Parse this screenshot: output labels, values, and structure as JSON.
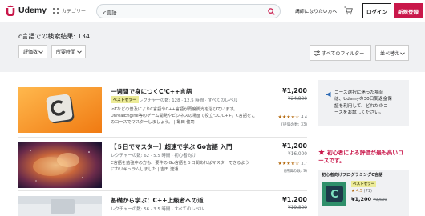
{
  "header": {
    "logo": "Udemy",
    "categories": "カテゴリー",
    "search_value": "c言語",
    "business_text": "講師になりたい方へ",
    "login": "ログイン",
    "signup": "新規登録"
  },
  "results": {
    "title": "c言語での検索結果: 134",
    "chip_rating": "評価数",
    "chip_duration": "所要時間",
    "all_filters": "すべてのフィルター",
    "sort": "並べ替え"
  },
  "courses": [
    {
      "title": "一週間で身につくC/C++言語",
      "badge": "ベストセラー",
      "meta": "レクチャーの数: 128 · 12.5 時間 · すべてのレベル",
      "desc_lines": [
        "IoTなどの普及によりC言語やC++言語が再度脚光を浴びています。",
        "UnrealEngine等のゲーム開発やビジネスの場面で役立つC/C++。C言語をこ",
        "のコースでマスターしましょう。 | 亀田 健司"
      ],
      "price": "¥1,200",
      "old_price": "¥24,800",
      "stars": "★★★★☆",
      "rating": "4.4",
      "reviews": "(評価の数: 33)"
    },
    {
      "title": "【５日でマスター】超速で学ぶ Go言語 入門",
      "meta": "レクチャーの数: 62 · 5.5 時間 · 初心者向け",
      "desc_lines": [
        "C言語を勉強中の方も、要件の Go言語を５日間あればマスターできるよう",
        "にカリキュラムしました | 吉田 遼通"
      ],
      "price": "¥1,200",
      "old_price": "¥16,000",
      "stars": "★★★★☆",
      "rating": "3.7",
      "reviews": "(評価の数: 9)"
    },
    {
      "title": "基礎から学ぶ：C++上級者への道",
      "meta": "レクチャーの数: 56 · 3.5 時間 · すべてのレベル",
      "price": "¥1,200",
      "old_price": "¥19,800"
    }
  ],
  "sidebar": {
    "note_lines": [
      "コース選択に迷った場合",
      "は、Udemyの30日間返金保",
      "証を利用して、どれかのコ",
      "ースをお試しください。"
    ],
    "popular_line1": "初心者による評価が最も高いコ",
    "popular_line2": "ースです。",
    "mini_title": "初心者向けプログラミングC言語",
    "mini_badge": "ベストセラー",
    "mini_rating": "★ 4.5",
    "mini_count": "(71)",
    "mini_price": "¥1,200",
    "mini_old_price": "¥9,600"
  },
  "colors": {
    "brand": "#c9174a",
    "star": "#b4690e",
    "band": "#f0f1f3"
  }
}
